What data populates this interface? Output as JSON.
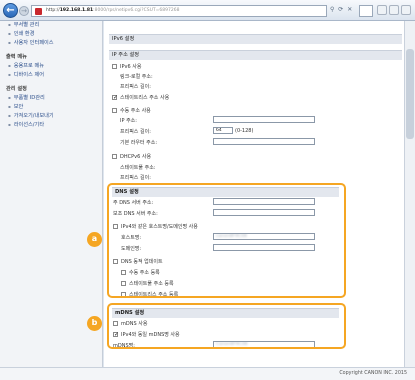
{
  "browser": {
    "url_prefix": "http://",
    "url_host": "192.168.1.81",
    "url_path": ":8000/rps/netipv6.cgi?CSUT=6897268"
  },
  "sidebar": {
    "items_top": [
      {
        "label": "부서별 관리"
      },
      {
        "label": "인쇄 환경"
      },
      {
        "label": "사용자 인터페이스"
      }
    ],
    "groups": [
      {
        "title": "출력 메뉴",
        "items": [
          {
            "label": "응용프로 메뉴"
          },
          {
            "label": "디바이스 제어"
          }
        ]
      },
      {
        "title": "관리 설정",
        "items": [
          {
            "label": "부품별 ID관리"
          },
          {
            "label": "보안"
          },
          {
            "label": "가져오기/내보내기"
          },
          {
            "label": "라이선스/기타"
          }
        ]
      }
    ]
  },
  "main": {
    "ipv6_section": "IPv6 설정",
    "ip_address_section": "IP 주소 설정",
    "use_ipv6": "IPv6 사용",
    "link_local": "링크-로컬 주소:",
    "prefix_length_label": "프리픽스 길이:",
    "stateless": "스테이트리스 주소 사용",
    "manual_address": "수동 주소 사용",
    "ip_address": "IP 주소:",
    "prefix_length": "프리픽스 길이:",
    "prefix_value": "64",
    "prefix_range": "(0-128)",
    "default_router": "기본 라우터 주소:",
    "dhcpv6": "DHCPv6 사용",
    "stateful_address": "스테이트풀 주소:",
    "stateful_prefix": "프리픽스 길이:",
    "dns_section": "DNS 설정",
    "primary_dns": "주 DNS 서버 주소:",
    "secondary_dns": "보조 DNS 서버 주소:",
    "same_host": "IPv4와 같은 호스트명/도메인명 사용",
    "host_name": "호스트명:",
    "host_value": "canon8F9C08",
    "domain_name": "도메인명:",
    "dynamic_update": "DNS 동적 업데이트",
    "register_manual": "수동 주소 등록",
    "register_stateful": "스테이트풀 주소 등록",
    "register_stateless": "스테이트리스 주소 등록",
    "mdns_section": "mDNS 설정",
    "use_mdns": "mDNS 사용",
    "same_mdns": "IPv4와 동일 mDNS명 사용",
    "mdns_name": "mDNS명:",
    "mdns_value": "Canon8F9C08"
  },
  "callouts": {
    "a": "a",
    "b": "b"
  },
  "footer": {
    "copyright": "Copyright CANON INC. 2015"
  }
}
